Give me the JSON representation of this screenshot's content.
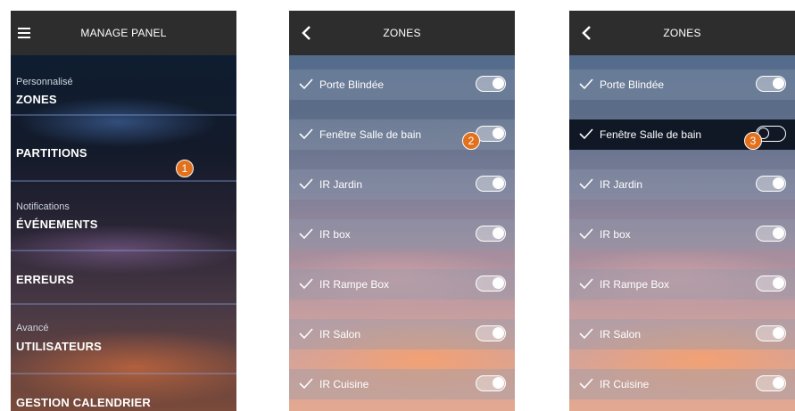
{
  "menu_screen": {
    "title": "MANAGE PANEL",
    "items": [
      {
        "small": "Personnalisé",
        "big": "ZONES"
      },
      {
        "small": "",
        "big": "PARTITIONS"
      },
      {
        "small": "Notifications",
        "big": "ÉVÉNEMENTS"
      },
      {
        "small": "",
        "big": "ERREURS"
      },
      {
        "small": "Avancé",
        "big": "UTILISATEURS"
      },
      {
        "small": "",
        "big": "GESTION CALENDRIER"
      }
    ],
    "badge": "1"
  },
  "zones_screen_1": {
    "title": "ZONES",
    "zones": [
      {
        "label": "Porte Blindée",
        "on": true
      },
      {
        "label": "Fenêtre Salle de bain",
        "on": true
      },
      {
        "label": "IR Jardin",
        "on": true
      },
      {
        "label": "IR box",
        "on": true
      },
      {
        "label": "IR Rampe Box",
        "on": true
      },
      {
        "label": "IR Salon",
        "on": true
      },
      {
        "label": "IR Cuisine",
        "on": true
      }
    ],
    "badge": "2"
  },
  "zones_screen_2": {
    "title": "ZONES",
    "zones": [
      {
        "label": "Porte Blindée",
        "on": true
      },
      {
        "label": "Fenêtre Salle de bain",
        "on": false
      },
      {
        "label": "IR Jardin",
        "on": true
      },
      {
        "label": "IR box",
        "on": true
      },
      {
        "label": "IR Rampe Box",
        "on": true
      },
      {
        "label": "IR Salon",
        "on": true
      },
      {
        "label": "IR Cuisine",
        "on": true
      }
    ],
    "badge": "3"
  },
  "colors": {
    "badge": "#e2711d",
    "topbar": "#2d2d2d"
  },
  "icons": {
    "menu": "hamburger-icon",
    "back": "back-arrow-icon",
    "check": "checkmark-icon"
  }
}
